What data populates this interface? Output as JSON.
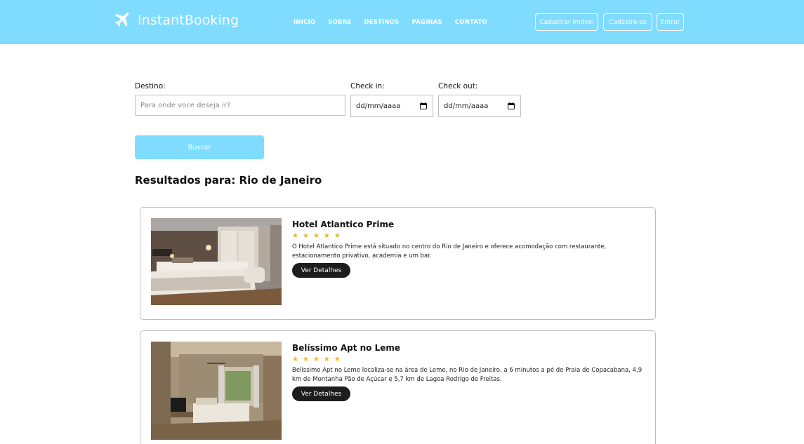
{
  "header": {
    "brand": "InstantBooking",
    "brand_icon": "airplane-icon",
    "background": "#7fdcff",
    "nav": [
      "INICIO",
      "SOBRE",
      "DESTINOS",
      "PÁGINAS",
      "CONTATO"
    ],
    "buttons": {
      "cadastrar_imovel": "Cadastrar imóvel",
      "cadastre_se": "Cadastre-se",
      "entrar": "Entrar"
    }
  },
  "search": {
    "destino_label": "Destino:",
    "destino_placeholder": "Para onde voce deseja ir?",
    "checkin_label": "Check in:",
    "checkin_value": "dd/mm/aaaa",
    "checkout_label": "Check out:",
    "checkout_value": "dd/mm/aaaa",
    "calendar_icon": "calendar-icon",
    "buscar_label": "Buscar"
  },
  "results": {
    "heading": "Resultados para: Rio de Janeiro",
    "items": [
      {
        "title": "Hotel Atlantico Prime",
        "rating": 5,
        "stars": "★",
        "description": "O Hotel Atlantico Prime está situado no centro do Rio de Janeiro e oferece acomodação com restaurante, estacionamento privativo, academia e um bar.",
        "button": "Ver Detalhes"
      },
      {
        "title": "Belíssimo Apt no Leme",
        "rating": 5,
        "stars": "★",
        "description": "Belíssimo Apt no Leme localiza-se na área de Leme, no Rio de Janeiro, a 6 minutos a pé de Praia de Copacabana, 4,9 km de Montanha Pão de Açúcar e 5,7 km de Lagoa Rodrigo de Freitas.",
        "button": "Ver Detalhes"
      }
    ]
  },
  "colors": {
    "accent": "#7fdcff",
    "star": "#f0b429",
    "button_dark": "#1d1d1d"
  }
}
